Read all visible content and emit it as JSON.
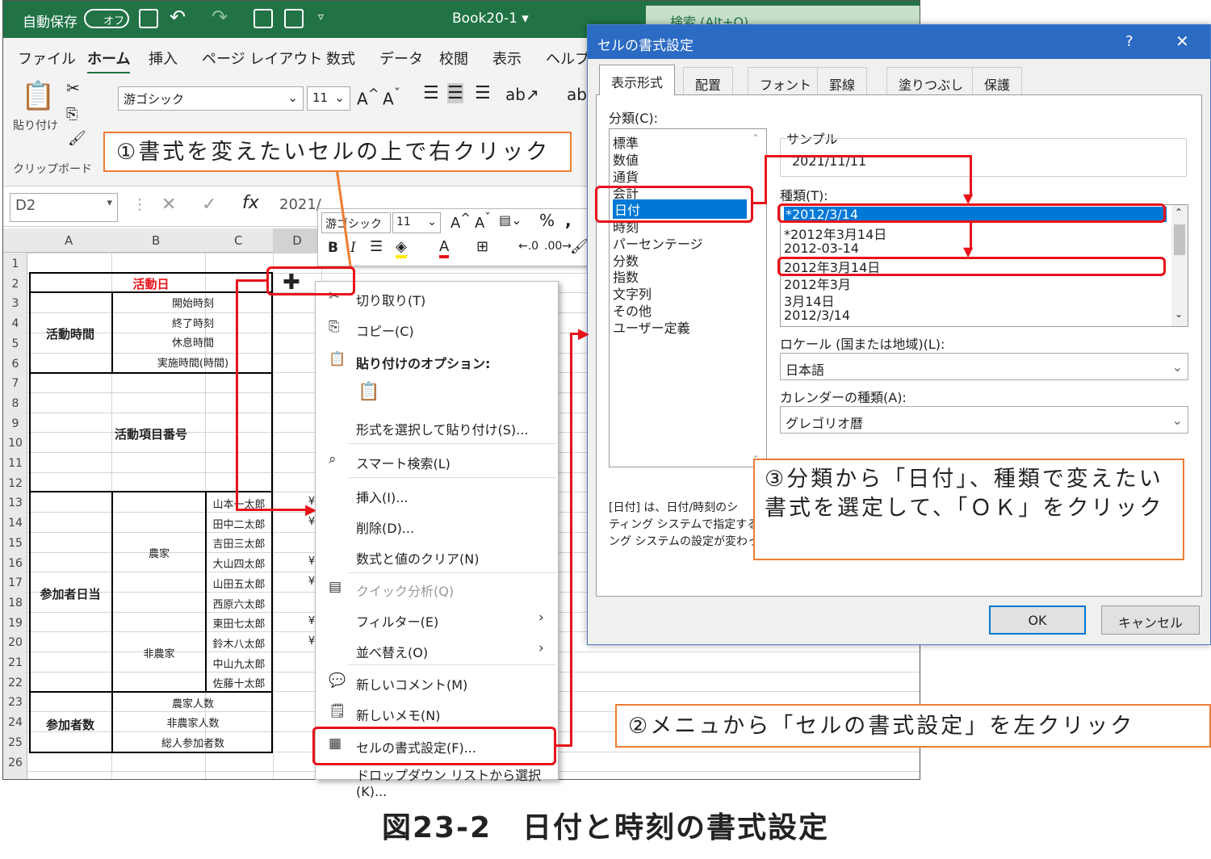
{
  "excel": {
    "autosave": "自動保存",
    "autosave_toggle": "オフ",
    "book_title": "Book20-1",
    "search_placeholder": "検索 (Alt+Q)",
    "tabs": [
      "ファイル",
      "ホーム",
      "挿入",
      "ページ レイアウト",
      "数式",
      "データ",
      "校閲",
      "表示",
      "ヘルプ"
    ],
    "active_tab": "ホーム",
    "paste_label": "貼り付け",
    "clipboard_label": "クリップボード",
    "font_name": "游ゴシック",
    "font_size": "11",
    "name_box": "D2",
    "formula_value": "2021/11/11",
    "columns": [
      "A",
      "B",
      "C",
      "D"
    ],
    "rows": [
      "1",
      "2",
      "3",
      "4",
      "5",
      "6",
      "7",
      "8",
      "9",
      "10",
      "11",
      "12",
      "13",
      "14",
      "15",
      "16",
      "17",
      "18",
      "19",
      "20",
      "21",
      "22",
      "23",
      "24",
      "25",
      "26"
    ],
    "cells": {
      "activity_day": "活動日",
      "activity_time": "活動時間",
      "start_time": "開始時刻",
      "end_time": "終了時刻",
      "break_time": "休息時間",
      "work_hours": "実施時間(時間)",
      "activity_item_no": "活動項目番号",
      "participants_daily": "参加者日当",
      "farmer": "農家",
      "non_farmer": "非農家",
      "names": [
        "山本一太郎",
        "田中二太郎",
        "吉田三太郎",
        "大山四太郎",
        "山田五太郎",
        "西原六太郎",
        "東田七太郎",
        "鈴木八太郎",
        "中山九太郎",
        "佐藤十太郎"
      ],
      "participant_count": "参加者数",
      "farmer_count": "農家人数",
      "non_farmer_count": "非農家人数",
      "total_count": "総人参加者数",
      "yen": "¥"
    }
  },
  "mini_toolbar": {
    "font": "游ゴシック",
    "size": "11",
    "percent": "%"
  },
  "context_menu": {
    "items": [
      {
        "icon": "✂",
        "label": "切り取り(T)"
      },
      {
        "icon": "⎘",
        "label": "コピー(C)"
      },
      {
        "icon": "📋",
        "label": "貼り付けのオプション:"
      },
      {
        "icon": "",
        "label": "形式を選択して貼り付け(S)..."
      },
      {
        "icon": "⌕",
        "label": "スマート検索(L)"
      },
      {
        "icon": "",
        "label": "挿入(I)..."
      },
      {
        "icon": "",
        "label": "削除(D)..."
      },
      {
        "icon": "",
        "label": "数式と値のクリア(N)"
      },
      {
        "icon": "▤",
        "label": "クイック分析(Q)"
      },
      {
        "icon": "",
        "label": "フィルター(E)"
      },
      {
        "icon": "",
        "label": "並べ替え(O)"
      },
      {
        "icon": "💬",
        "label": "新しいコメント(M)"
      },
      {
        "icon": "🗒",
        "label": "新しいメモ(N)"
      },
      {
        "icon": "▦",
        "label": "セルの書式設定(F)..."
      },
      {
        "icon": "",
        "label": "ドロップダウン リストから選択(K)..."
      }
    ]
  },
  "dialog": {
    "title": "セルの書式設定",
    "help": "?",
    "close": "✕",
    "tabs": [
      "表示形式",
      "配置",
      "フォント",
      "罫線",
      "塗りつぶし",
      "保護"
    ],
    "category_label": "分類(C):",
    "categories": [
      "標準",
      "数値",
      "通貨",
      "会計",
      "日付",
      "時刻",
      "パーセンテージ",
      "分数",
      "指数",
      "文字列",
      "その他",
      "ユーザー定義"
    ],
    "selected_category": "日付",
    "sample_label": "サンプル",
    "sample_value": "2021/11/11",
    "type_label": "種類(T):",
    "types": [
      "*2012/3/14",
      "*2012年3月14日",
      "2012-03-14",
      "2012年3月14日",
      "2012年3月",
      "3月14日",
      "2012/3/14"
    ],
    "selected_type": "*2012/3/14",
    "locale_label": "ロケール (国または地域)(L):",
    "locale_value": "日本語",
    "calendar_label": "カレンダーの種類(A):",
    "calendar_value": "グレゴリオ暦",
    "description": "[日付] は、日付/時刻のシ\nティング システムで指定する\nング システムの設定が変わっ",
    "ok": "OK",
    "cancel": "キャンセル"
  },
  "callouts": {
    "step1": "①書式を変えたいセルの上で右クリック",
    "step2": "②メニュから「セルの書式設定」を左クリック",
    "step3": "③分類から「日付」、種類で変えたい書式を選定して、「ＯＫ」をクリック"
  },
  "caption": "図23-2　日付と時刻の書式設定",
  "colors": {
    "excel_green": "#217346",
    "dialog_blue": "#2b6bc4",
    "callout_orange": "#ed7d31",
    "highlight_red": "#e8121a",
    "selection_blue": "#0078d7"
  }
}
